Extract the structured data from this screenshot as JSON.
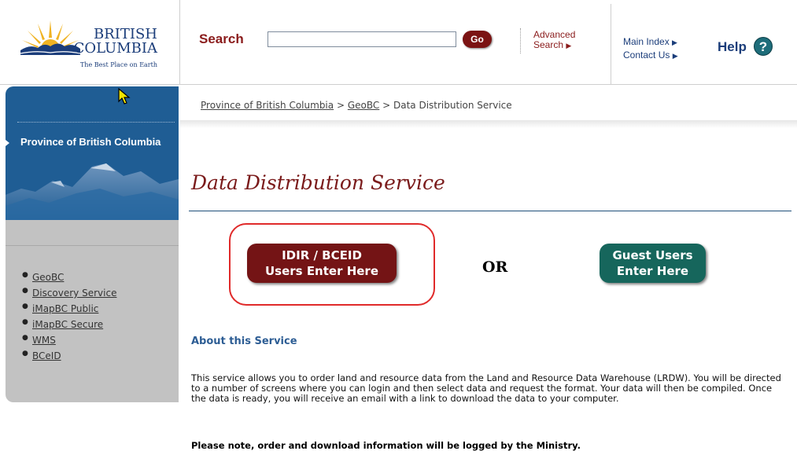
{
  "header": {
    "logo": {
      "line1": "BRITISH",
      "line2": "COLUMBIA",
      "tagline": "The Best Place on Earth"
    },
    "search": {
      "label": "Search",
      "value": "",
      "placeholder": "",
      "go_label": "Go"
    },
    "advanced_search": {
      "line1": "Advanced",
      "line2": "Search"
    },
    "links": {
      "main_index": "Main Index",
      "contact_us": "Contact Us"
    },
    "help": {
      "label": "Help",
      "icon_glyph": "?"
    }
  },
  "sidebar": {
    "title": "Province of British Columbia",
    "links": [
      "GeoBC",
      "Discovery Service",
      "iMapBC Public",
      "iMapBC Secure",
      "WMS",
      "BCeID"
    ]
  },
  "breadcrumb": {
    "items": [
      "Province of British Columbia",
      "GeoBC",
      "Data Distribution Service"
    ],
    "separator": ">"
  },
  "main": {
    "title": "Data Distribution Service",
    "idir_button": {
      "line1": "IDIR / BCEID",
      "line2": "Users Enter Here"
    },
    "or_label": "OR",
    "guest_button": {
      "line1": "Guest Users",
      "line2": "Enter Here"
    },
    "about_heading": "About this Service",
    "about_text": "This service allows you to order land and resource data from the Land and Resource Data Warehouse (LRDW). You will be directed to a number of screens where you can login and then select data and request the format. Your data will then be compiled. Once the data is ready, you will receive an email with a link to download the data to your computer.",
    "note": "Please note, order and download information will be logged by the Ministry."
  },
  "colors": {
    "brand_blue": "#1b3d7a",
    "title_maroon": "#7a1a1a",
    "idir_button": "#741415",
    "guest_button": "#16665c",
    "highlight_ring": "#e02a2a"
  }
}
